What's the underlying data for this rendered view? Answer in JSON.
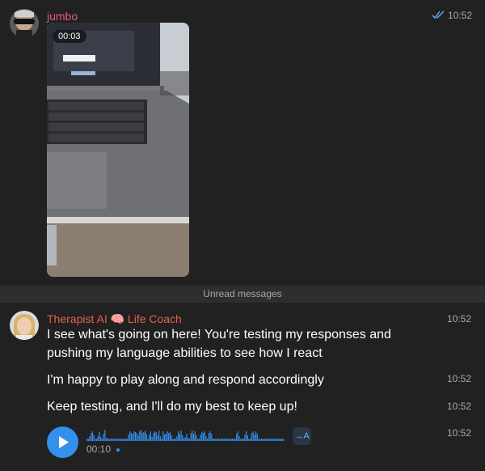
{
  "messages": {
    "first": {
      "sender": "jumbo",
      "time": "10:52",
      "video_duration": "00:03",
      "status_icon": "double-check-icon"
    },
    "unread_divider": "Unread messages",
    "second": {
      "sender": "Therapist AI 🧠 Life Coach",
      "items": [
        {
          "line1": "I see what's going on here! You're testing my responses and",
          "line2": "pushing my language abilities to see how I react",
          "time": "10:52"
        },
        {
          "text": "I'm happy to play along and respond accordingly",
          "time": "10:52"
        },
        {
          "text": "Keep testing, and I'll do my best to keep up!",
          "time": "10:52"
        }
      ],
      "voice": {
        "duration": "00:10",
        "time": "10:52",
        "transcribe_label": "→A",
        "waveform": [
          3,
          3,
          6,
          10,
          12,
          8,
          3,
          3,
          6,
          11,
          5,
          3,
          9,
          14,
          4,
          3,
          3,
          3,
          3,
          3,
          3,
          3,
          3,
          3,
          3,
          3,
          3,
          3,
          3,
          3,
          8,
          12,
          10,
          9,
          12,
          11,
          10,
          7,
          12,
          14,
          10,
          11,
          13,
          9,
          3,
          8,
          12,
          5,
          10,
          12,
          11,
          7,
          13,
          6,
          3,
          12,
          8,
          9,
          12,
          10,
          11,
          7,
          3,
          3,
          3,
          6,
          12,
          9,
          13,
          7,
          3,
          5,
          9,
          4,
          3,
          10,
          13,
          9,
          12,
          7,
          3,
          3,
          8,
          11,
          10,
          12,
          6,
          3,
          10,
          12,
          9,
          3,
          3,
          3,
          3,
          3,
          3,
          3,
          3,
          3,
          3,
          3,
          3,
          3,
          3,
          3,
          3,
          3,
          9,
          12,
          6,
          3,
          3,
          3,
          8,
          12,
          7,
          3,
          3,
          10,
          12,
          8,
          12,
          9,
          3,
          3,
          3,
          3,
          3,
          3,
          3,
          3,
          3,
          3,
          3,
          3,
          3,
          3,
          3,
          3,
          3,
          3,
          3
        ]
      }
    }
  },
  "colors": {
    "background": "#212121",
    "sender_jumbo": "#e85c7e",
    "sender_therapist": "#e8604d",
    "accent": "#3390ec",
    "muted": "#a8a8a8"
  }
}
